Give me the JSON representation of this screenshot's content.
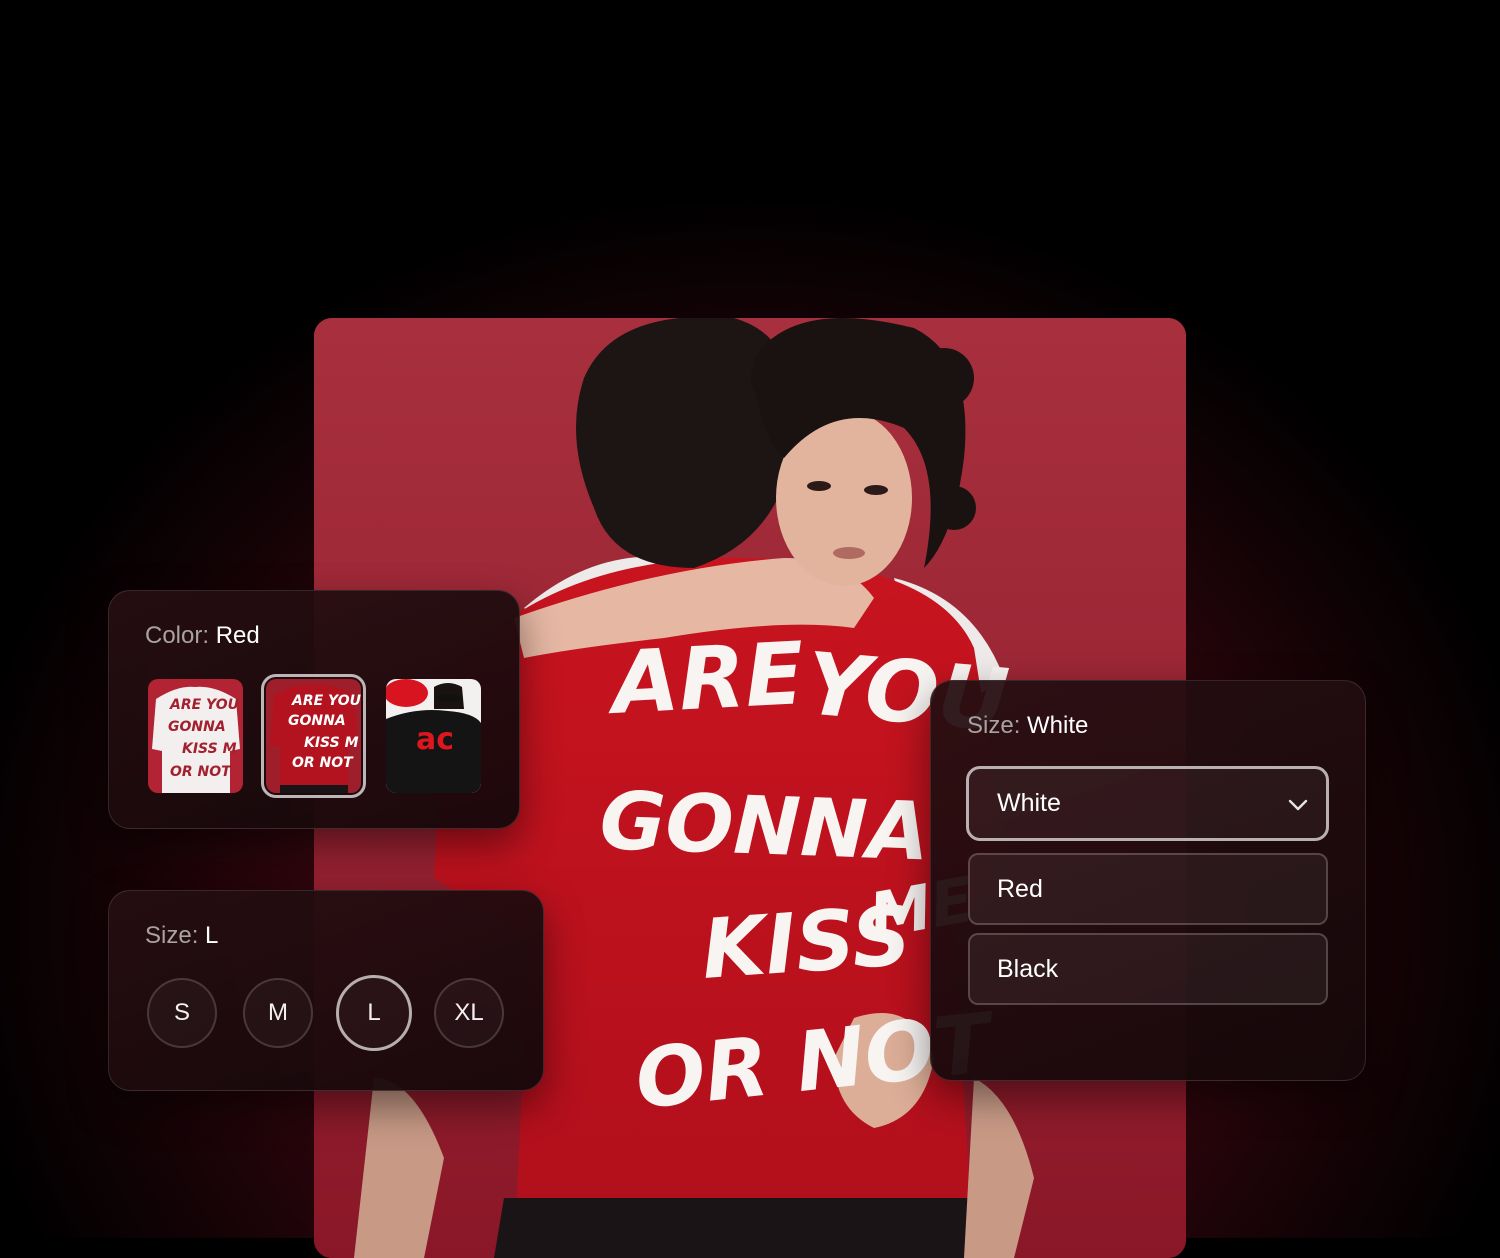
{
  "color_selector": {
    "label": "Color:",
    "value": "Red",
    "swatches": [
      {
        "name": "White tee",
        "shirt_color": "#f2efee",
        "text_color": "#a3202e",
        "text_lines": [
          "ARE YOU",
          "GONNA",
          "KISS ME",
          "OR NOT"
        ]
      },
      {
        "name": "Red tee",
        "shirt_color": "#b3121f",
        "text_color": "#ffffff",
        "text_lines": [
          "ARE YOU",
          "GONNA",
          "KISS ME",
          "OR NOT"
        ]
      },
      {
        "name": "Black tee",
        "shirt_color": "#141414",
        "text_color": "#e0161f",
        "text_lines": [
          "ac"
        ]
      }
    ],
    "selected_index": 1
  },
  "size_selector": {
    "label": "Size:",
    "value": "L",
    "options": [
      "S",
      "M",
      "L",
      "XL"
    ],
    "selected_index": 2
  },
  "size_dropdown": {
    "label": "Size:",
    "value": "White",
    "selected": "White",
    "options": [
      "Red",
      "Black"
    ]
  },
  "hero": {
    "shirt_lines": [
      "ARE YOU",
      "GONNA",
      "KISS ME",
      "OR NOT"
    ],
    "background_color": "#a32a38",
    "shirt_color": "#c2121f"
  }
}
